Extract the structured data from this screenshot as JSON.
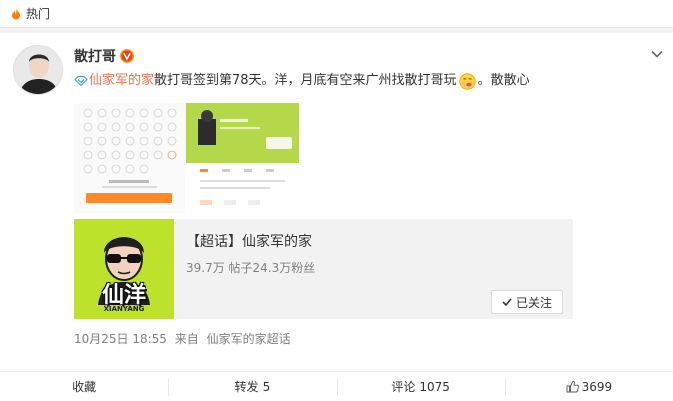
{
  "header": {
    "title": "热门"
  },
  "post": {
    "user": {
      "name": "散打哥"
    },
    "text": {
      "topic": "仙家军的家",
      "body": " 散打哥签到第78天。洋，月底有空来广州找散打哥玩",
      "tail": "。散散心"
    },
    "meta": {
      "time": "10月25日 18:55",
      "from_prefix": "来自",
      "source": "仙家军的家超话"
    }
  },
  "topic_card": {
    "title": "【超话】仙家军的家",
    "stats": "39.7万 帖子24.3万粉丝",
    "follow_label": "已关注",
    "image_name": "仙洋",
    "image_sub": "XIANYANG"
  },
  "actions": {
    "collect": "收藏",
    "repost": "转发",
    "repost_count": "5",
    "comment": "评论",
    "comment_count": "1075",
    "like_count": "3699"
  },
  "colors": {
    "accent": "#eb7350",
    "lime": "#bde22b"
  }
}
